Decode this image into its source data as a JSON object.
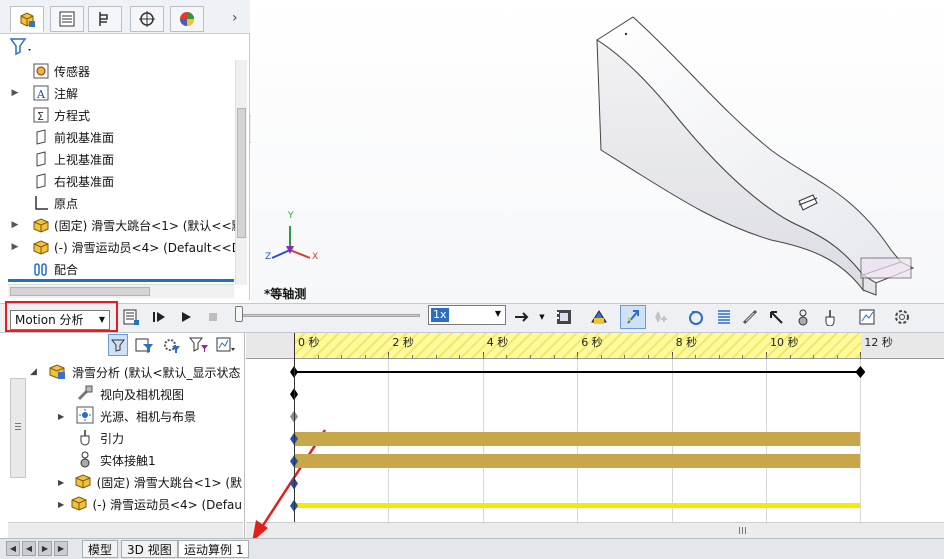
{
  "feature_tree": {
    "items": [
      {
        "label": "传感器",
        "icon": "sensor-icon",
        "expandable": false
      },
      {
        "label": "注解",
        "icon": "annotation-icon",
        "expandable": true
      },
      {
        "label": "方程式",
        "icon": "equation-icon",
        "expandable": false
      },
      {
        "label": "前视基准面",
        "icon": "plane-icon",
        "expandable": false
      },
      {
        "label": "上视基准面",
        "icon": "plane-icon",
        "expandable": false
      },
      {
        "label": "右视基准面",
        "icon": "plane-icon",
        "expandable": false
      },
      {
        "label": "原点",
        "icon": "origin-icon",
        "expandable": false
      },
      {
        "label": "(固定) 滑雪大跳台<1> (默认<<默",
        "icon": "part-icon",
        "expandable": true
      },
      {
        "label": "(-) 滑雪运动员<4> (Default<<D",
        "icon": "part-icon",
        "expandable": true
      },
      {
        "label": "配合",
        "icon": "mates-icon",
        "expandable": false
      }
    ]
  },
  "viewport": {
    "view_label": "*等轴测",
    "triad": {
      "x": "X",
      "y": "Y",
      "z": "Z"
    }
  },
  "motion_toolbar": {
    "study_type": "Motion 分析",
    "playback_speed": "1x"
  },
  "motion_tree": {
    "rows": [
      {
        "label": "滑雪分析 (默认<默认_显示状态",
        "icon": "study-icon",
        "expand": "down"
      },
      {
        "label": "视向及相机视图",
        "icon": "camera-view-icon",
        "expand": "none"
      },
      {
        "label": "光源、相机与布景",
        "icon": "lights-icon",
        "expand": "right"
      },
      {
        "label": "引力",
        "icon": "gravity-icon",
        "expand": "none"
      },
      {
        "label": "实体接触1",
        "icon": "contact-icon",
        "expand": "none"
      },
      {
        "label": "(固定) 滑雪大跳台<1> (默",
        "icon": "part-icon",
        "expand": "right"
      },
      {
        "label": "(-) 滑雪运动员<4> (Defau",
        "icon": "part-icon",
        "expand": "right"
      }
    ]
  },
  "timeline": {
    "ticks": [
      "0 秒",
      "2 秒",
      "4 秒",
      "6 秒",
      "8 秒",
      "10 秒",
      "12 秒"
    ],
    "duration_seconds": 12,
    "tracks": [
      {
        "kind": "key-line",
        "color": "#000000"
      },
      {
        "kind": "key-only",
        "color": "#000000"
      },
      {
        "kind": "key-only",
        "color": "#8a8a8a"
      },
      {
        "kind": "bar",
        "color": "#c8a64a"
      },
      {
        "kind": "bar",
        "color": "#c8a64a"
      },
      {
        "kind": "key-only",
        "color": "#1f4fb8"
      },
      {
        "kind": "line",
        "color": "#f5ea00"
      }
    ]
  },
  "bottom_tabs": [
    "模型",
    "3D 视图",
    "运动算例 1"
  ],
  "active_tab": "运动算例 1",
  "colors": {
    "highlight_red": "#e0201c",
    "timeline_yellow": "#fffa9c",
    "track_gold": "#c8a64a"
  }
}
